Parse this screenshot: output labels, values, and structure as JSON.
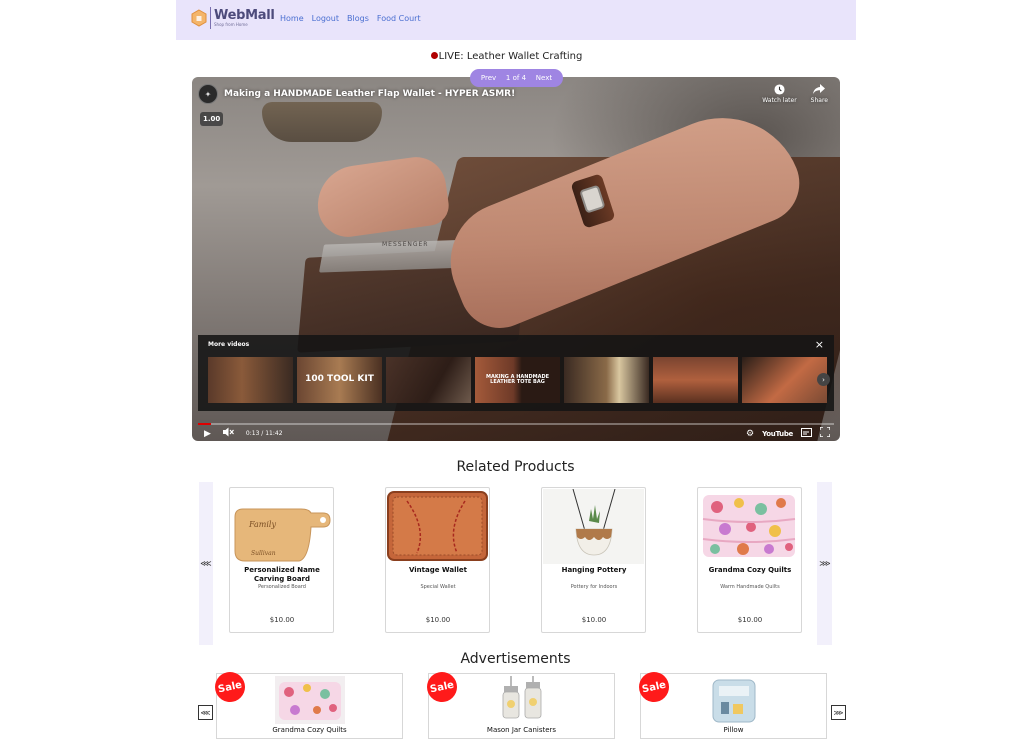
{
  "navbar": {
    "logo_title": "WebMall",
    "logo_subtitle": "Shop from Home",
    "links": [
      "Home",
      "Logout",
      "Blogs",
      "Food Court"
    ]
  },
  "live": {
    "title": "LIVE: Leather Wallet Crafting"
  },
  "pager": {
    "prev": "Prev",
    "page": "1 of 4",
    "next": "Next"
  },
  "video": {
    "title": "Making a HANDMADE Leather Flap Wallet - HYPER ASMR!",
    "watch_later": "Watch later",
    "share": "Share",
    "speed": "1.00",
    "template_text": "MESSENGER",
    "more_videos_label": "More videos",
    "thumbs": [
      {
        "text": ""
      },
      {
        "text": "100 TOOL KIT"
      },
      {
        "text": ""
      },
      {
        "text": "MAKING A HANDMADE LEATHER TOTE BAG"
      },
      {
        "text": ""
      },
      {
        "text": ""
      },
      {
        "text": ""
      }
    ],
    "time": "0:13 / 11:42",
    "progress_fraction": 0.02,
    "youtube_label": "YouTube"
  },
  "related": {
    "title": "Related Products",
    "products": [
      {
        "name": "Personalized Name Carving Board",
        "desc": "Personalized Board",
        "price": "$10.00"
      },
      {
        "name": "Vintage Wallet",
        "desc": "Special Wallet",
        "price": "$10.00"
      },
      {
        "name": "Hanging Pottery",
        "desc": "Pottery for Indoors",
        "price": "$10.00"
      },
      {
        "name": "Grandma Cozy Quilts",
        "desc": "Warm Handmade Quilts",
        "price": "$10.00"
      }
    ]
  },
  "ads": {
    "title": "Advertisements",
    "sale_label": "Sale",
    "items": [
      {
        "name": "Grandma Cozy Quilts"
      },
      {
        "name": "Mason Jar Canisters"
      },
      {
        "name": "Pillow"
      }
    ]
  },
  "colors": {
    "navbar_bg": "#e9e4fb",
    "accent": "#9f85e3",
    "link": "#4a6fd1",
    "sale": "#ff1a1a",
    "progress": "#e00000"
  }
}
